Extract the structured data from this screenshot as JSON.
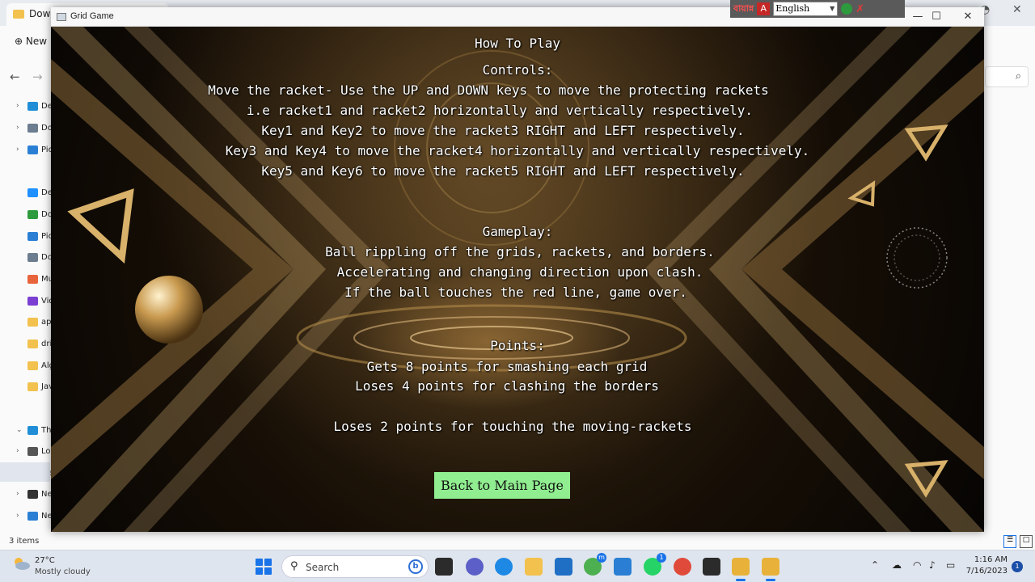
{
  "explorer": {
    "tab_title": "Down",
    "new_label": "New",
    "sidebar": [
      {
        "label": "De",
        "color": "#1f8ed6"
      },
      {
        "label": "Do",
        "color": "#6b7d8f"
      },
      {
        "label": "Pic",
        "color": "#2a7fd4"
      },
      {
        "label": "Des",
        "color": "#1e90ff"
      },
      {
        "label": "Dow",
        "color": "#2e9a3e"
      },
      {
        "label": "Pictu",
        "color": "#2a7fd4"
      },
      {
        "label": "Doc",
        "color": "#6b7d8f"
      },
      {
        "label": "Mus",
        "color": "#e8643a"
      },
      {
        "label": "Vide",
        "color": "#7b3fd1"
      },
      {
        "label": "app",
        "color": "#f2c14e"
      },
      {
        "label": "driv",
        "color": "#f2c14e"
      },
      {
        "label": "Algo",
        "color": "#f2c14e"
      },
      {
        "label": "Java",
        "color": "#f2c14e"
      },
      {
        "label": "This",
        "color": "#1f8ed6"
      },
      {
        "label": "Lo",
        "color": "#555555"
      },
      {
        "label": "Ne",
        "color": "#333333"
      },
      {
        "label": "Ne",
        "color": "#333333"
      },
      {
        "label": "Netv",
        "color": "#2a7fd4"
      }
    ],
    "status": "3 items"
  },
  "langbar": {
    "logo_text": "বায়ান্ন",
    "red_icon": "A",
    "language": "English"
  },
  "window": {
    "title": "Grid Game",
    "minimize_icon": "—",
    "maximize_icon": "☐",
    "close_icon": "✕"
  },
  "how_to_play": {
    "heading": "How To Play",
    "controls_heading": "Controls:",
    "controls": [
      "Move the racket- Use the UP and DOWN keys to move the protecting rackets",
      "i.e racket1 and racket2 horizontally and vertically respectively.",
      "Key1 and Key2 to move the racket3 RIGHT and LEFT respectively.",
      "Key3 and Key4 to move the racket4 horizontally and vertically respectively.",
      "Key5 and Key6 to move the racket5 RIGHT and LEFT respectively."
    ],
    "gameplay_heading": "Gameplay:",
    "gameplay": [
      "Ball rippling off the grids, rackets, and borders.",
      "Accelerating and changing direction upon clash.",
      "If the ball touches the red line, game over."
    ],
    "points_heading": "Points:",
    "points": [
      "Gets 8 points for smashing each grid",
      "Loses 4 points for clashing the borders",
      "Loses 2 points for touching the moving-rackets"
    ],
    "back_button": "Back to Main Page"
  },
  "taskbar": {
    "weather_temp": "27°C",
    "weather_desc": "Mostly cloudy",
    "search_placeholder": "Search",
    "time": "1:16 AM",
    "date": "7/16/2023",
    "badges": {
      "chrome_m": "m",
      "whatsapp": "1",
      "notifications": "1"
    }
  }
}
